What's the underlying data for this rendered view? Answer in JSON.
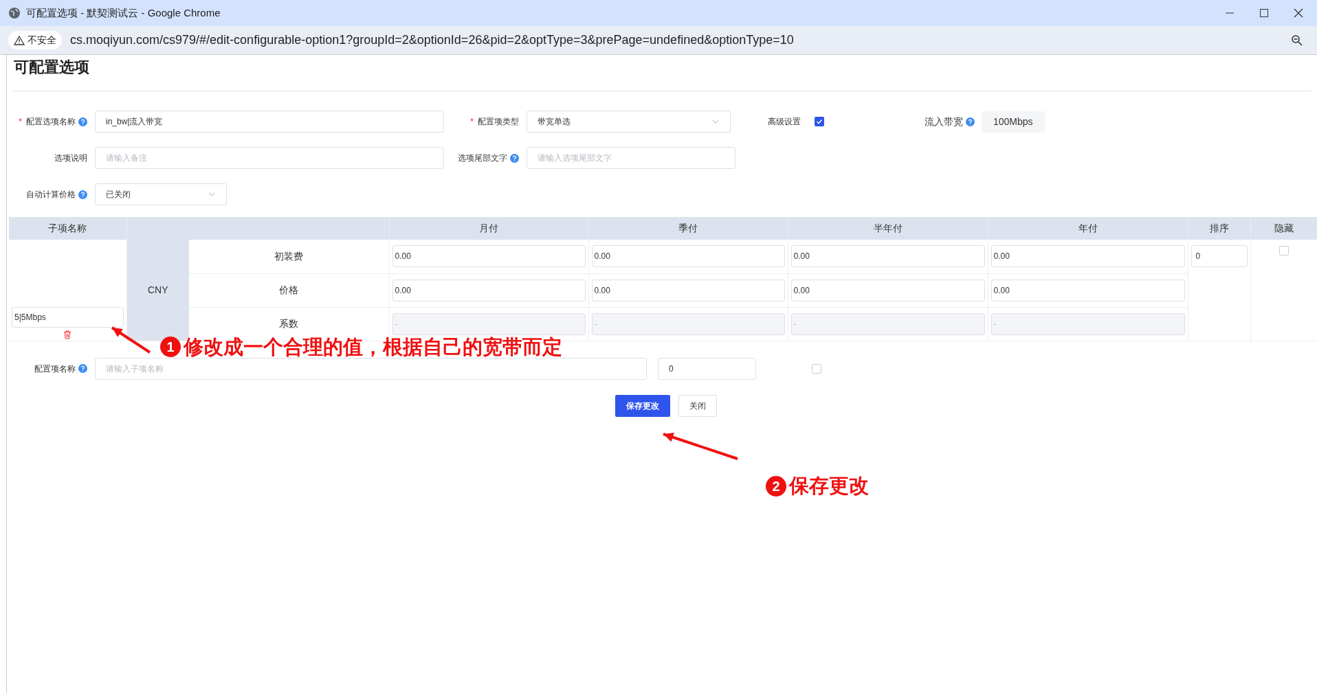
{
  "browser": {
    "title": "可配置选项 - 默契测试云 - Google Chrome",
    "security_label": "不安全",
    "url": "cs.moqiyun.com/cs979/#/edit-configurable-option1?groupId=2&optionId=26&pid=2&optType=3&prePage=undefined&optionType=10"
  },
  "page_title": "可配置选项",
  "form_rows": [
    [
      {
        "kind": "input",
        "required_mark": "*",
        "label": "配置选项名称",
        "help": true,
        "value": "in_bw|流入带宽"
      },
      {
        "kind": "select",
        "required_mark": "*",
        "label": "配置项类型",
        "help": false,
        "value": "带宽单选"
      },
      {
        "kind": "checkbox",
        "label": "高级设置",
        "checked": true
      },
      {
        "kind": "readout",
        "label": "流入带宽",
        "help": true,
        "value": "100Mbps"
      }
    ],
    [
      {
        "kind": "input",
        "label": "选项说明",
        "help": false,
        "placeholder": "请输入备注"
      },
      {
        "kind": "input",
        "label": "选项尾部文字",
        "help": true,
        "placeholder": "请输入选项尾部文字"
      }
    ],
    [
      {
        "kind": "select",
        "label": "自动计算价格",
        "help": true,
        "value": "已关闭"
      }
    ]
  ],
  "table": {
    "columns": [
      "子项名称",
      "月付",
      "季付",
      "半年付",
      "年付",
      "排序",
      "隐藏"
    ],
    "item": {
      "name": "5|5Mbps",
      "currency": "CNY",
      "sort": "0",
      "hidden": false,
      "rows": [
        {
          "label": "初装费",
          "disabled": false,
          "cells": [
            "0.00",
            "0.00",
            "0.00",
            "0.00"
          ]
        },
        {
          "label": "价格",
          "disabled": false,
          "cells": [
            "0.00",
            "0.00",
            "0.00",
            "0.00"
          ]
        },
        {
          "label": "系数",
          "disabled": true,
          "cells": [
            "-",
            "-",
            "-",
            "-"
          ]
        }
      ]
    }
  },
  "new_item": {
    "label": "配置项名称",
    "help": true,
    "placeholder": "请输入子项名称",
    "sort": "0",
    "hidden": false
  },
  "buttons": [
    {
      "label": "保存更改",
      "primary": true
    },
    {
      "label": "关闭",
      "primary": false
    }
  ],
  "annotations": [
    {
      "number": "1",
      "text": "修改成一个合理的值，根据自己的宽带而定"
    },
    {
      "number": "2",
      "text": "保存更改"
    }
  ]
}
